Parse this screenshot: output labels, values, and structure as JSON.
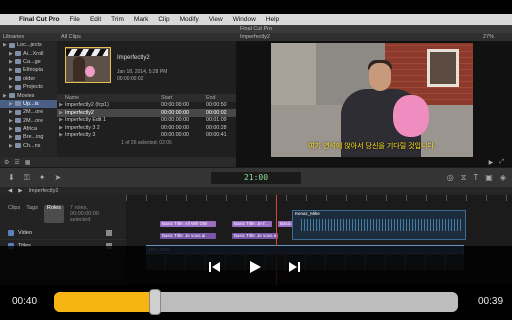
{
  "menubar": {
    "apple_glyph": "",
    "app_name": "Final Cut Pro",
    "items": [
      "File",
      "Edit",
      "Trim",
      "Mark",
      "Clip",
      "Modify",
      "View",
      "Window",
      "Help"
    ]
  },
  "window_title": "Final Cut Pro",
  "libraries": {
    "header": "Libraries",
    "rows": [
      {
        "label": "Loc...jects",
        "indent": false,
        "selected": false
      },
      {
        "label": "Ai...Xroll",
        "indent": true,
        "selected": false
      },
      {
        "label": "Ca...ge",
        "indent": true,
        "selected": false
      },
      {
        "label": "Ethiopia",
        "indent": true,
        "selected": false
      },
      {
        "label": "older",
        "indent": true,
        "selected": false
      },
      {
        "label": "Projects",
        "indent": true,
        "selected": false
      },
      {
        "label": "Movies",
        "indent": false,
        "selected": false
      },
      {
        "label": "Up...is",
        "indent": true,
        "selected": true
      },
      {
        "label": "2M...ore",
        "indent": true,
        "selected": false
      },
      {
        "label": "2M...ore",
        "indent": true,
        "selected": false
      },
      {
        "label": "Africa",
        "indent": true,
        "selected": false
      },
      {
        "label": "Bre...ing",
        "indent": true,
        "selected": false
      },
      {
        "label": "Ch...ns",
        "indent": true,
        "selected": false
      }
    ]
  },
  "browser": {
    "filter": "All Clips",
    "clip_title": "Imperfectly2",
    "clip_date": "Jan 18, 2014, 5:28 PM",
    "clip_duration": "00:00:00:02",
    "columns": [
      "Name",
      "Start",
      "End"
    ],
    "rows": [
      {
        "name": "Imperfectly2 (fcp1)",
        "start": "00:00:00:00",
        "end": "00:00:50",
        "selected": false
      },
      {
        "name": "Imperfectly2",
        "start": "00:00:00:00",
        "end": "00:00:02",
        "selected": true
      },
      {
        "name": "Imperfectly Edit 1",
        "start": "00:00:00:00",
        "end": "00:01:09",
        "selected": false
      },
      {
        "name": "Imperfectly 3 2",
        "start": "00:00:00:00",
        "end": "00:00:28",
        "selected": false
      },
      {
        "name": "Imperfectly 3",
        "start": "00:00:00:00",
        "end": "00:00:41",
        "selected": false
      }
    ],
    "selection_info": "1 of 26 selected, 02:05"
  },
  "viewer": {
    "title": "Imperfectly2",
    "zoom": "27%",
    "subtitle": "여기 연석에 앉아서 당신을 기다릴 것입니다."
  },
  "toolbar": {
    "timecode": "21:00"
  },
  "timeline": {
    "project_name": "Imperfectly2",
    "tabs": [
      "Clips",
      "Tags",
      "Roles"
    ],
    "active_tab": "Roles",
    "roles_count": "7 roles, 00:00:00:00 selected",
    "roles": [
      "Video",
      "Titles"
    ],
    "title_clips": [
      "Basic Title: All Will GW",
      "Basic Title: Je vous ai",
      "Basic Title: Je t'...",
      "Basic Title: Je vous ai",
      "Basic Title: Je...",
      "Kenaz_Mike"
    ],
    "primary_clip": "MVI_4066"
  },
  "player": {
    "current_time": "00:40",
    "end_time": "00:39",
    "progress": 0.25
  },
  "colors": {
    "progress_fill": "#f6b512",
    "subtitle": "#ffe31a",
    "timecode": "#8fe09c",
    "playhead": "#d7423a"
  }
}
